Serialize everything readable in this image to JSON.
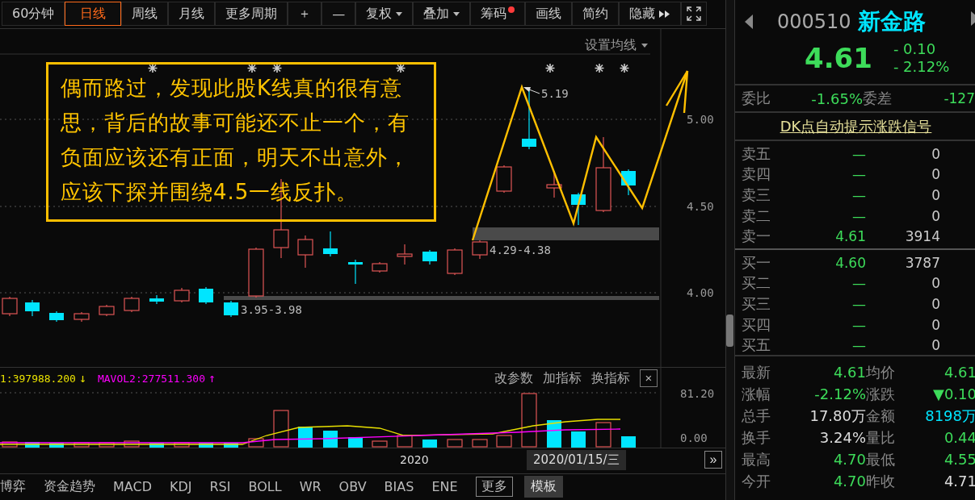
{
  "toolbar": [
    {
      "label": "60分钟",
      "selected": false,
      "kind": "period"
    },
    {
      "label": "日线",
      "selected": true,
      "kind": "period"
    },
    {
      "label": "周线",
      "selected": false,
      "kind": "period"
    },
    {
      "label": "月线",
      "selected": false,
      "kind": "period"
    },
    {
      "label": "更多周期",
      "selected": false,
      "kind": "period"
    },
    {
      "label": "＋",
      "selected": false,
      "kind": "period"
    },
    {
      "label": "—",
      "selected": false,
      "kind": "period"
    },
    {
      "label": "复权",
      "selected": false,
      "kind": "menu"
    },
    {
      "label": "叠加",
      "selected": false,
      "kind": "menu"
    },
    {
      "label": "筹码",
      "selected": false,
      "kind": "alert"
    },
    {
      "label": "画线",
      "selected": false,
      "kind": "period"
    },
    {
      "label": "简约",
      "selected": false,
      "kind": "period"
    },
    {
      "label": "隐藏",
      "selected": false,
      "kind": "expand"
    }
  ],
  "chart": {
    "ma_setting": "设置均线",
    "price_ticks": [
      "5.00",
      "4.50",
      "4.00"
    ],
    "high_label": "5.19",
    "zones": [
      "4.29-4.38",
      "3.95-3.98"
    ],
    "note": "偶而路过，发现此股K线真的很有意思，背后的故事可能还不止一个，有负面应该还有正面，明天不出意外，应该下探并围绕4.5一线反扑。"
  },
  "volume": {
    "legend": [
      {
        "text": "1:397988.200",
        "arrow": "↓",
        "kind": "mavol1"
      },
      {
        "text": "MAVOL2:277511.300",
        "arrow": "↑",
        "kind": "mavol2"
      }
    ],
    "actions": [
      "改参数",
      "加指标",
      "换指标"
    ],
    "close": "×",
    "ticks": [
      "81.20",
      "0.00"
    ]
  },
  "date_bar": {
    "year": "2020",
    "cursor_date": "2020/01/15/三",
    "next": "»"
  },
  "indicator_tabs": [
    {
      "label": "博弈",
      "kind": "indicator"
    },
    {
      "label": "资金趋势",
      "kind": "indicator"
    },
    {
      "label": "MACD",
      "kind": "indicator"
    },
    {
      "label": "KDJ",
      "kind": "indicator"
    },
    {
      "label": "RSI",
      "kind": "indicator"
    },
    {
      "label": "BOLL",
      "kind": "indicator"
    },
    {
      "label": "WR",
      "kind": "indicator"
    },
    {
      "label": "OBV",
      "kind": "indicator"
    },
    {
      "label": "BIAS",
      "kind": "indicator"
    },
    {
      "label": "ENE",
      "kind": "indicator"
    },
    {
      "label": "更多",
      "kind": "more"
    },
    {
      "label": "模板",
      "kind": "template"
    }
  ],
  "quote": {
    "code": "000510",
    "name": "新金路",
    "price": "4.61",
    "change": "- 0.10",
    "change_pct": "- 2.12%"
  },
  "order_ratio": [
    {
      "label": "委比",
      "value": "-1.65%"
    },
    {
      "label": "委差",
      "value": "-127"
    }
  ],
  "signal_link": "DK点自动提示涨跌信号",
  "sells": [
    {
      "label": "卖五",
      "price": "—",
      "volume": "0"
    },
    {
      "label": "卖四",
      "price": "—",
      "volume": "0"
    },
    {
      "label": "卖三",
      "price": "—",
      "volume": "0"
    },
    {
      "label": "卖二",
      "price": "—",
      "volume": "0"
    },
    {
      "label": "卖一",
      "price": "4.61",
      "volume": "3914"
    }
  ],
  "buys": [
    {
      "label": "买一",
      "price": "4.60",
      "volume": "3787"
    },
    {
      "label": "买二",
      "price": "—",
      "volume": "0"
    },
    {
      "label": "买三",
      "price": "—",
      "volume": "0"
    },
    {
      "label": "买四",
      "price": "—",
      "volume": "0"
    },
    {
      "label": "买五",
      "price": "—",
      "volume": "0"
    }
  ],
  "stats": [
    {
      "label": "最新",
      "value": "4.61",
      "kind": "price"
    },
    {
      "label": "均价",
      "value": "4.61",
      "kind": "price"
    },
    {
      "label": "涨幅",
      "value": "-2.12%",
      "kind": "price"
    },
    {
      "label": "涨跌",
      "value": "▼0.10",
      "kind": "price"
    },
    {
      "label": "总手",
      "value": "17.80万",
      "kind": "plain"
    },
    {
      "label": "金额",
      "value": "8198万",
      "kind": "amount"
    },
    {
      "label": "换手",
      "value": "3.24%",
      "kind": "plain"
    },
    {
      "label": "量比",
      "value": "0.44",
      "kind": "price"
    },
    {
      "label": "最高",
      "value": "4.70",
      "kind": "price"
    },
    {
      "label": "最低",
      "value": "4.55",
      "kind": "price"
    },
    {
      "label": "今开",
      "value": "4.70",
      "kind": "price"
    },
    {
      "label": "昨收",
      "value": "4.71",
      "kind": "plain"
    }
  ]
}
